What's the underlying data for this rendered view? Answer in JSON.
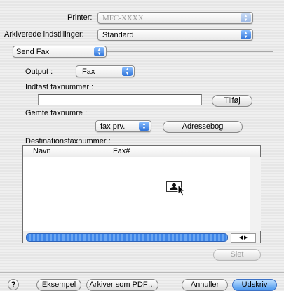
{
  "printer": {
    "label": "Printer:",
    "value": "MFC-XXXX"
  },
  "presets": {
    "label": "Arkiverede indstillinger:",
    "value": "Standard"
  },
  "panel": {
    "value": "Send Fax"
  },
  "output": {
    "label": "Output :",
    "value": "Fax"
  },
  "fax_entry": {
    "label": "Indtast faxnummer :",
    "value": "",
    "add_button": "Tilføj"
  },
  "saved": {
    "label": "Gemte faxnumre :",
    "value": "fax prv.",
    "addressbook_button": "Adressebog"
  },
  "destinations": {
    "label": "Destinationsfaxnummer :",
    "columns": [
      "Navn",
      "Fax#"
    ],
    "rows": [],
    "delete_button": "Slet"
  },
  "footer": {
    "help": "?",
    "preview": "Eksempel",
    "save_pdf": "Arkiver som PDF…",
    "cancel": "Annuller",
    "print": "Udskriv"
  },
  "colors": {
    "accent": "#4a97ee",
    "scrollbar": "#3f86e8"
  },
  "icons": {
    "popup_arrows": "⬍",
    "cursor": "arrow-cursor-icon",
    "contact": "contact-card-icon"
  }
}
